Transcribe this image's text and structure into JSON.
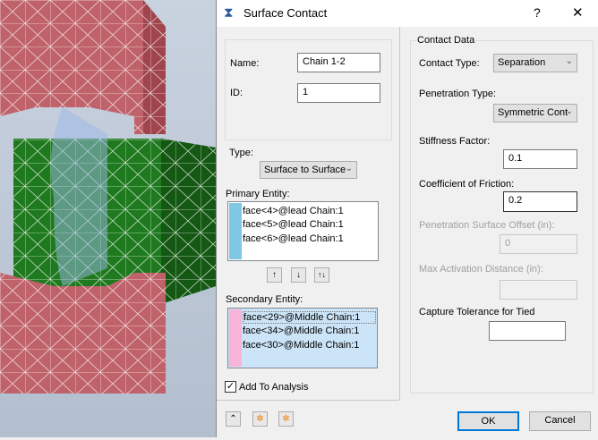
{
  "dialog": {
    "title": "Surface Contact",
    "help": "?",
    "close": "✕"
  },
  "general": {
    "name_label": "Name:",
    "name_value": "Chain 1-2",
    "id_label": "ID:",
    "id_value": "1"
  },
  "type": {
    "label": "Type:",
    "value": "Surface to Surface"
  },
  "primary": {
    "label": "Primary Entity:",
    "color": "#7ec8e3",
    "items": [
      "face<4>@lead Chain:1",
      "face<5>@lead Chain:1",
      "face<6>@lead Chain:1"
    ]
  },
  "order_buttons": {
    "up": "↑",
    "down": "↓",
    "swap": "↑↓"
  },
  "secondary": {
    "label": "Secondary Entity:",
    "color": "#f7b3d8",
    "items": [
      "face<29>@Middle Chain:1",
      "face<34>@Middle Chain:1",
      "face<30>@Middle Chain:1"
    ]
  },
  "add_to_analysis": {
    "label": "Add To Analysis",
    "checked": true
  },
  "contact_data": {
    "title": "Contact Data",
    "contact_type_label": "Contact Type:",
    "contact_type_value": "Separation",
    "penetration_type_label": "Penetration Type:",
    "penetration_type_value": "Symmetric Cont",
    "stiffness_label": "Stiffness Factor:",
    "stiffness_value": "0.1",
    "friction_label": "Coefficient of Friction:",
    "friction_value": "0.2",
    "pen_offset_label": "Penetration Surface Offset (in):",
    "pen_offset_value": "0",
    "max_activation_label": "Max Activation Distance (in):",
    "max_activation_value": "",
    "capture_label": "Capture Tolerance for Tied",
    "capture_value": ""
  },
  "footer": {
    "ok": "OK",
    "cancel": "Cancel"
  }
}
